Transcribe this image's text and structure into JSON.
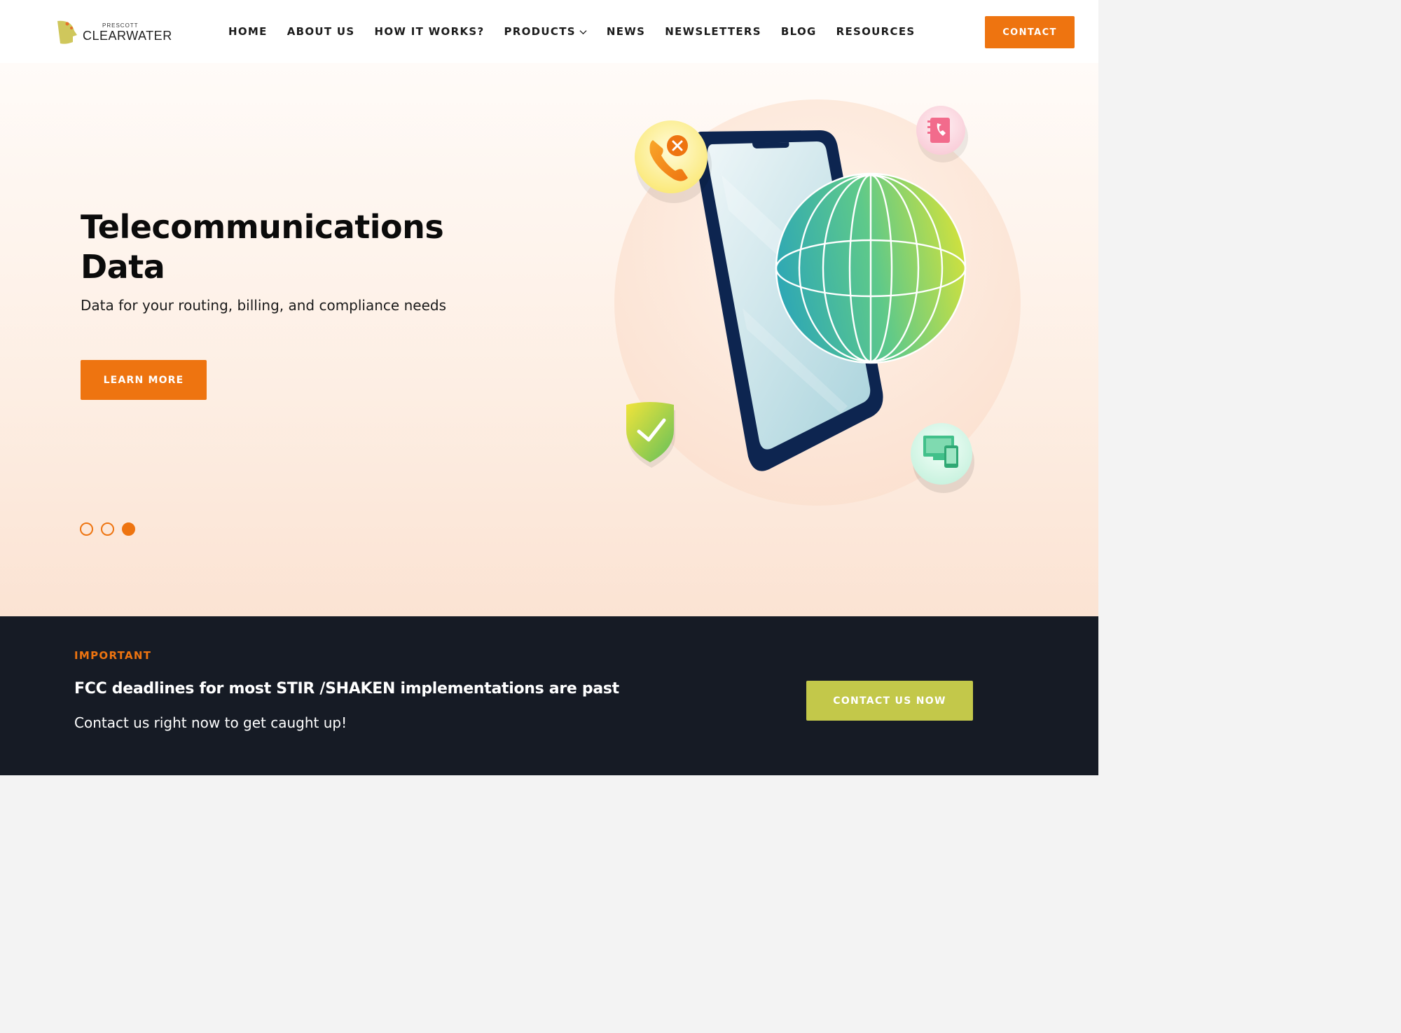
{
  "header": {
    "logo": {
      "small": "PRESCOTT",
      "big": "CLEARWATER"
    },
    "nav": [
      {
        "label": "HOME",
        "has_dropdown": false
      },
      {
        "label": "ABOUT US",
        "has_dropdown": false
      },
      {
        "label": "HOW IT WORKS?",
        "has_dropdown": false
      },
      {
        "label": "PRODUCTS",
        "has_dropdown": true
      },
      {
        "label": "NEWS",
        "has_dropdown": false
      },
      {
        "label": "NEWSLETTERS",
        "has_dropdown": false
      },
      {
        "label": "BLOG",
        "has_dropdown": false
      },
      {
        "label": "RESOURCES",
        "has_dropdown": false
      }
    ],
    "contact_label": "CONTACT"
  },
  "hero": {
    "title": "Telecommunications Data",
    "subtitle": "Data for your routing, billing, and compliance needs",
    "cta_label": "LEARN MORE",
    "slides_total": 3,
    "active_slide": 3,
    "illustration_icons": [
      "blocked-call-icon",
      "phone-book-icon",
      "shield-check-icon",
      "devices-icon",
      "globe-icon",
      "smartphone-icon"
    ]
  },
  "important": {
    "label": "IMPORTANT",
    "title": "FCC deadlines for most STIR /SHAKEN implementations are past",
    "subtitle": "Contact us right now to get caught up!",
    "cta_label": "CONTACT US NOW"
  },
  "colors": {
    "accent": "#ee7410",
    "band_bg": "#161b25",
    "band_button": "#c3c84a"
  }
}
